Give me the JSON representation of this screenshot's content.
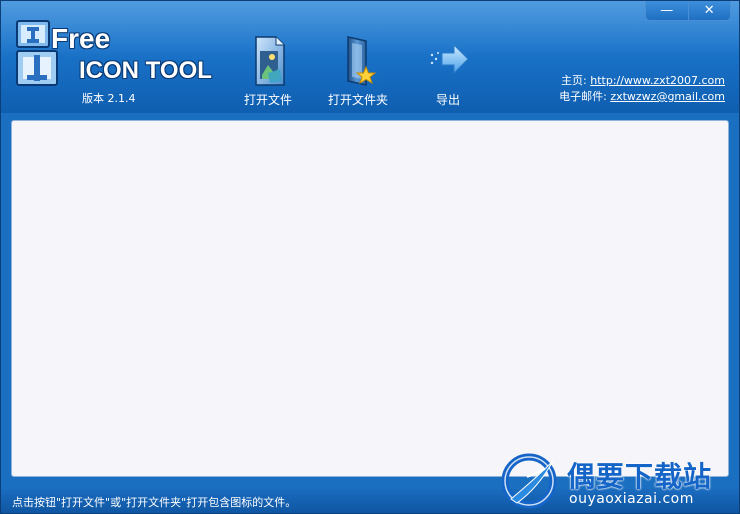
{
  "window": {
    "controls": {
      "minimize": "—",
      "close": "✕"
    }
  },
  "logo": {
    "free": "Free",
    "tool": "ICON TOOL",
    "version": "版本 2.1.4"
  },
  "toolbar": {
    "open_file": "打开文件",
    "open_folder": "打开文件夹",
    "export": "导出"
  },
  "links": {
    "home_label": "主页:",
    "home_url": "http://www.zxt2007.com",
    "email_label": "电子邮件:",
    "email": "zxtwzwz@gmail.com"
  },
  "statusbar": {
    "text": "点击按钮\"打开文件\"或\"打开文件夹\"打开包含图标的文件。"
  },
  "watermark": {
    "title": "偶要下载站",
    "subtitle": "ouyaoxiazai.com"
  },
  "colors": {
    "header_top": "#2a85d8",
    "header_bottom": "#0f5eb0",
    "content_bg": "#f6f5f9",
    "watermark_text": "#1565c8"
  },
  "icons": {
    "open_file": "document-image-icon",
    "open_folder": "folder-star-icon",
    "export": "arrow-right-icon",
    "logo": "i-free-logo-icon"
  }
}
